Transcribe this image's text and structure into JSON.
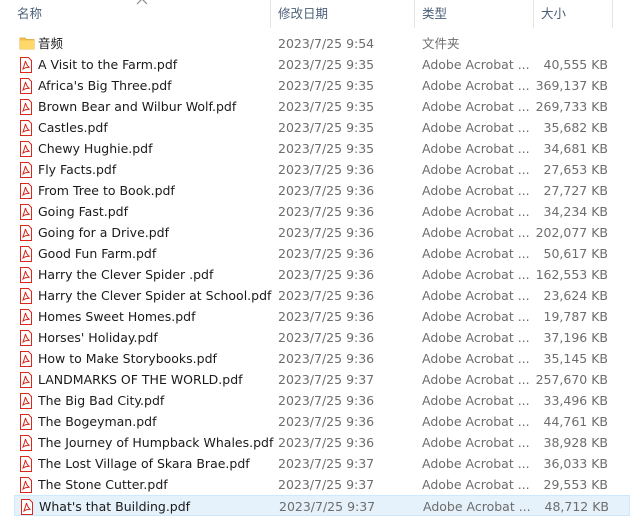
{
  "columns": {
    "name": "名称",
    "date": "修改日期",
    "type": "类型",
    "size": "大小"
  },
  "colors": {
    "header_text": "#4c607a",
    "pdf_red": "#d9271c",
    "folder_yellow": "#f4c14c",
    "selected_bg": "#e5f1fb"
  },
  "rows": [
    {
      "icon": "folder-icon",
      "name": "音频",
      "date": "2023/7/25 9:54",
      "type": "文件夹",
      "size": ""
    },
    {
      "icon": "pdf-icon",
      "name": "A Visit to the Farm.pdf",
      "date": "2023/7/25 9:35",
      "type": "Adobe Acrobat ...",
      "size": "40,555 KB"
    },
    {
      "icon": "pdf-icon",
      "name": "Africa's Big Three.pdf",
      "date": "2023/7/25 9:35",
      "type": "Adobe Acrobat ...",
      "size": "369,137 KB"
    },
    {
      "icon": "pdf-icon",
      "name": "Brown Bear and Wilbur Wolf.pdf",
      "date": "2023/7/25 9:35",
      "type": "Adobe Acrobat ...",
      "size": "269,733 KB"
    },
    {
      "icon": "pdf-icon",
      "name": "Castles.pdf",
      "date": "2023/7/25 9:35",
      "type": "Adobe Acrobat ...",
      "size": "35,682 KB"
    },
    {
      "icon": "pdf-icon",
      "name": "Chewy Hughie.pdf",
      "date": "2023/7/25 9:35",
      "type": "Adobe Acrobat ...",
      "size": "34,681 KB"
    },
    {
      "icon": "pdf-icon",
      "name": "Fly Facts.pdf",
      "date": "2023/7/25 9:36",
      "type": "Adobe Acrobat ...",
      "size": "27,653 KB"
    },
    {
      "icon": "pdf-icon",
      "name": "From Tree to Book.pdf",
      "date": "2023/7/25 9:36",
      "type": "Adobe Acrobat ...",
      "size": "27,727 KB"
    },
    {
      "icon": "pdf-icon",
      "name": "Going Fast.pdf",
      "date": "2023/7/25 9:36",
      "type": "Adobe Acrobat ...",
      "size": "34,234 KB"
    },
    {
      "icon": "pdf-icon",
      "name": "Going for a Drive.pdf",
      "date": "2023/7/25 9:36",
      "type": "Adobe Acrobat ...",
      "size": "202,077 KB"
    },
    {
      "icon": "pdf-icon",
      "name": "Good Fun Farm.pdf",
      "date": "2023/7/25 9:36",
      "type": "Adobe Acrobat ...",
      "size": "50,617 KB"
    },
    {
      "icon": "pdf-icon",
      "name": "Harry the Clever Spider .pdf",
      "date": "2023/7/25 9:36",
      "type": "Adobe Acrobat ...",
      "size": "162,553 KB"
    },
    {
      "icon": "pdf-icon",
      "name": "Harry the Clever Spider at School.pdf",
      "date": "2023/7/25 9:36",
      "type": "Adobe Acrobat ...",
      "size": "23,624 KB"
    },
    {
      "icon": "pdf-icon",
      "name": "Homes Sweet Homes.pdf",
      "date": "2023/7/25 9:36",
      "type": "Adobe Acrobat ...",
      "size": "19,787 KB"
    },
    {
      "icon": "pdf-icon",
      "name": "Horses' Holiday.pdf",
      "date": "2023/7/25 9:36",
      "type": "Adobe Acrobat ...",
      "size": "37,196 KB"
    },
    {
      "icon": "pdf-icon",
      "name": "How to Make Storybooks.pdf",
      "date": "2023/7/25 9:36",
      "type": "Adobe Acrobat ...",
      "size": "35,145 KB"
    },
    {
      "icon": "pdf-icon",
      "name": "LANDMARKS OF THE WORLD.pdf",
      "date": "2023/7/25 9:37",
      "type": "Adobe Acrobat ...",
      "size": "257,670 KB"
    },
    {
      "icon": "pdf-icon",
      "name": "The Big Bad City.pdf",
      "date": "2023/7/25 9:36",
      "type": "Adobe Acrobat ...",
      "size": "33,496 KB"
    },
    {
      "icon": "pdf-icon",
      "name": "The Bogeyman.pdf",
      "date": "2023/7/25 9:36",
      "type": "Adobe Acrobat ...",
      "size": "44,761 KB"
    },
    {
      "icon": "pdf-icon",
      "name": "The Journey of Humpback Whales.pdf",
      "date": "2023/7/25 9:36",
      "type": "Adobe Acrobat ...",
      "size": "38,928 KB"
    },
    {
      "icon": "pdf-icon",
      "name": "The Lost Village of Skara Brae.pdf",
      "date": "2023/7/25 9:37",
      "type": "Adobe Acrobat ...",
      "size": "36,033 KB"
    },
    {
      "icon": "pdf-icon",
      "name": "The Stone Cutter.pdf",
      "date": "2023/7/25 9:37",
      "type": "Adobe Acrobat ...",
      "size": "29,553 KB"
    },
    {
      "icon": "pdf-icon",
      "name": "What's that Building.pdf",
      "date": "2023/7/25 9:37",
      "type": "Adobe Acrobat ...",
      "size": "48,712 KB",
      "selected": true
    }
  ]
}
